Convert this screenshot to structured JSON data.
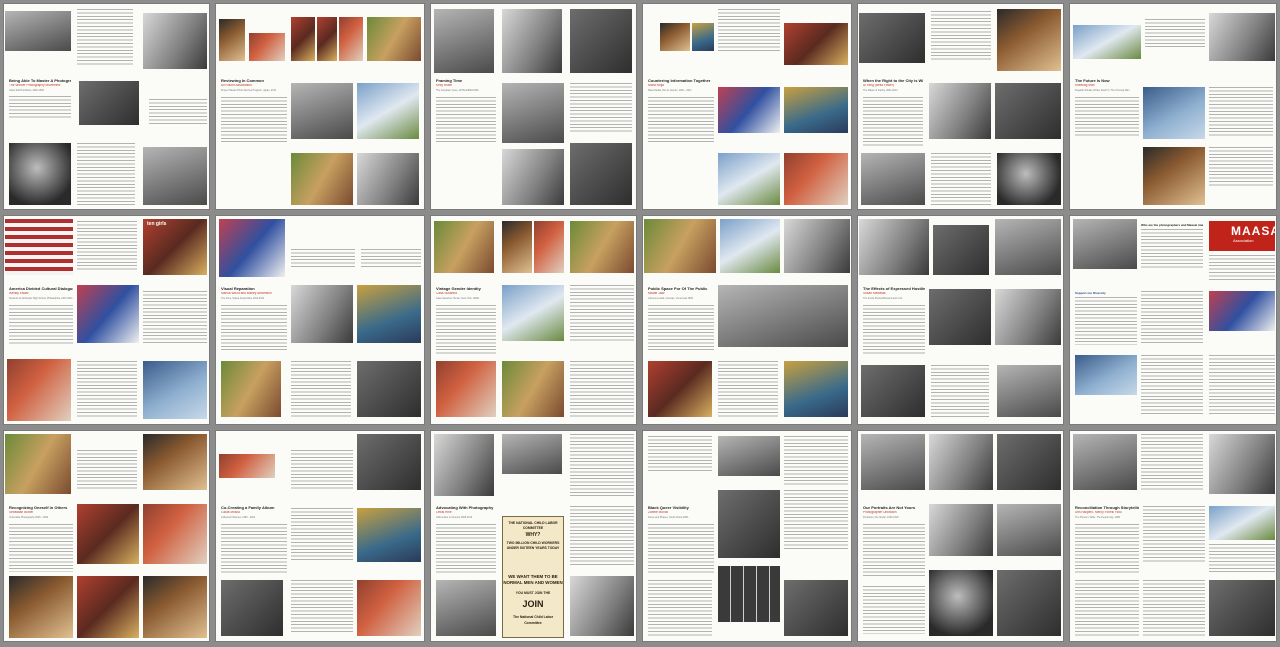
{
  "wall": {
    "spreads": [
      {
        "id": "spread-1",
        "heading": "Being Able To Master A Photographic Culture",
        "subheading": "The Worker Photography Movement",
        "meta": "Class Self-Portraiture 1926-1939",
        "quote_attr": "Jorge Ribalta, The Worker Photography Movement, 1926-1939",
        "end_attr": "- Jorge Ribalta",
        "caption": "Photograph Collection 'Frontiers of the Worker' by Aliyana-Rogers"
      },
      {
        "id": "spread-2",
        "heading": "Reviewing In Common",
        "subheading": "All Round Association",
        "meta": "Project Taiwan Photo Review Program, Japan, 2011",
        "end_attr": "- All Round Association",
        "footer_attr": "A.S.S."
      },
      {
        "id": "spread-3",
        "heading": "Framing Time",
        "subheading": "Kelly Rubin",
        "meta": "The Forgotten Ones, 1970s/1980s/1990",
        "end_attr": "- Kelly Rubin"
      },
      {
        "id": "spread-4",
        "heading": "Countering Information Together",
        "subheading": "Mídia Ninja",
        "meta": "Mass Media, Rio de Janeiro, 2001 - 2011",
        "end_attr": "- Mídia Ninja"
      },
      {
        "id": "spread-5",
        "heading": "When the Right to the City is Withdrawn",
        "subheading": "Ai Yang (Bella Foster)",
        "meta": "The Matter of Family, 2001-2014",
        "end_attr": "- Ai Yang"
      },
      {
        "id": "spread-6",
        "heading": "The Future Is Now",
        "subheading": "Kneeling Man",
        "meta": "Dugaldo Shirelle (Poker fields?) / The Oirsinas Man",
        "end_attr": "- A.S.S."
      },
      {
        "id": "spread-7",
        "heading": "America Divided Cultural Dialogue",
        "subheading": "Wendy Ewald",
        "meta": "Students at Northeast High School, Philadelphia, 2007-2011",
        "sign_text": "ten girls"
      },
      {
        "id": "spread-8",
        "heading": "Visual Reparation",
        "subheading": "Marcia Wood and Marley Abramson",
        "meta": "The Zone, Ngiwa Kuela Mare 2012-2014",
        "end_attr": "- Hasina"
      },
      {
        "id": "spread-9",
        "heading": "Vintage Gender Identity",
        "subheading": "Casa Susanna",
        "meta": "Casa Susanna, Hunter, New York, 1960s",
        "end_attr": "- Michel Hurst"
      },
      {
        "id": "spread-10",
        "heading": "Public Space For Of The Public",
        "subheading": "Mikael Jazz",
        "meta": "Camera Lucida, Caracas, Venezuela 1996",
        "end_attr": "- Mikael Jazz"
      },
      {
        "id": "spread-11",
        "heading": "The Effects of Expressed Hostile Victims",
        "subheading": "Susan Meiselas",
        "meta": "The Kurds Photos/Mission/Land of Ar.",
        "end_attr": "- Susan Meiselas"
      },
      {
        "id": "spread-12",
        "heading": "MAASAI",
        "subheading": "Association",
        "question": "Who are the photographers and Maasai images?",
        "support_heading": "Support our Diversity"
      },
      {
        "id": "spread-13",
        "heading": "Recognizing Oneself in Others",
        "subheading": "Sebastian Buhler",
        "meta": "Vulnerable Photography 2006 - 2009",
        "end_attr": "- Sebastian Buhler"
      },
      {
        "id": "spread-14",
        "heading": "Co-Creating a Family Album",
        "subheading": "Lucas Mosca",
        "meta": "Collected Histories, 1996 - 2004",
        "end_attr": "- Lucas Mosca"
      },
      {
        "id": "spread-15",
        "heading": "Advocating With Photography",
        "subheading": "Lewis Hine",
        "meta": "Child Labor in America 1908-1912",
        "poster_lines": [
          "THE NATIONAL CHILD LABOR",
          "COMMITTEE",
          "WHY?",
          "TWO MILLION CHILD WORKERS",
          "UNDER SIXTEEN YEARS TODAY",
          "WE WANT THEM TO BE",
          "NORMAL MEN AND WOMEN",
          "YOU MUST JOIN THE",
          "JOIN",
          "The National Child Labor",
          "Committee"
        ]
      },
      {
        "id": "spread-16",
        "heading": "Black Queer Visibility",
        "subheading": "Zanele Muholi",
        "meta": "Faces and Phases, South Africa 2006-",
        "end_attr": "- Zanele Muholi"
      },
      {
        "id": "spread-17",
        "heading": "Our Portraits Are Not Yours",
        "subheading": "Photographer Unknown",
        "meta": "Portraits in the Studio, 1900-1926",
        "end_attr": "- Tsoho Ndiaye"
      },
      {
        "id": "spread-18",
        "heading": "Reconciliation Through Storytelling",
        "subheading": "Uris Nisipero, Mercy Fonelli Fiolo",
        "meta": "The Picture's Table, The People Say, 1989",
        "end_attr": "- Uris Nisipero"
      }
    ]
  }
}
